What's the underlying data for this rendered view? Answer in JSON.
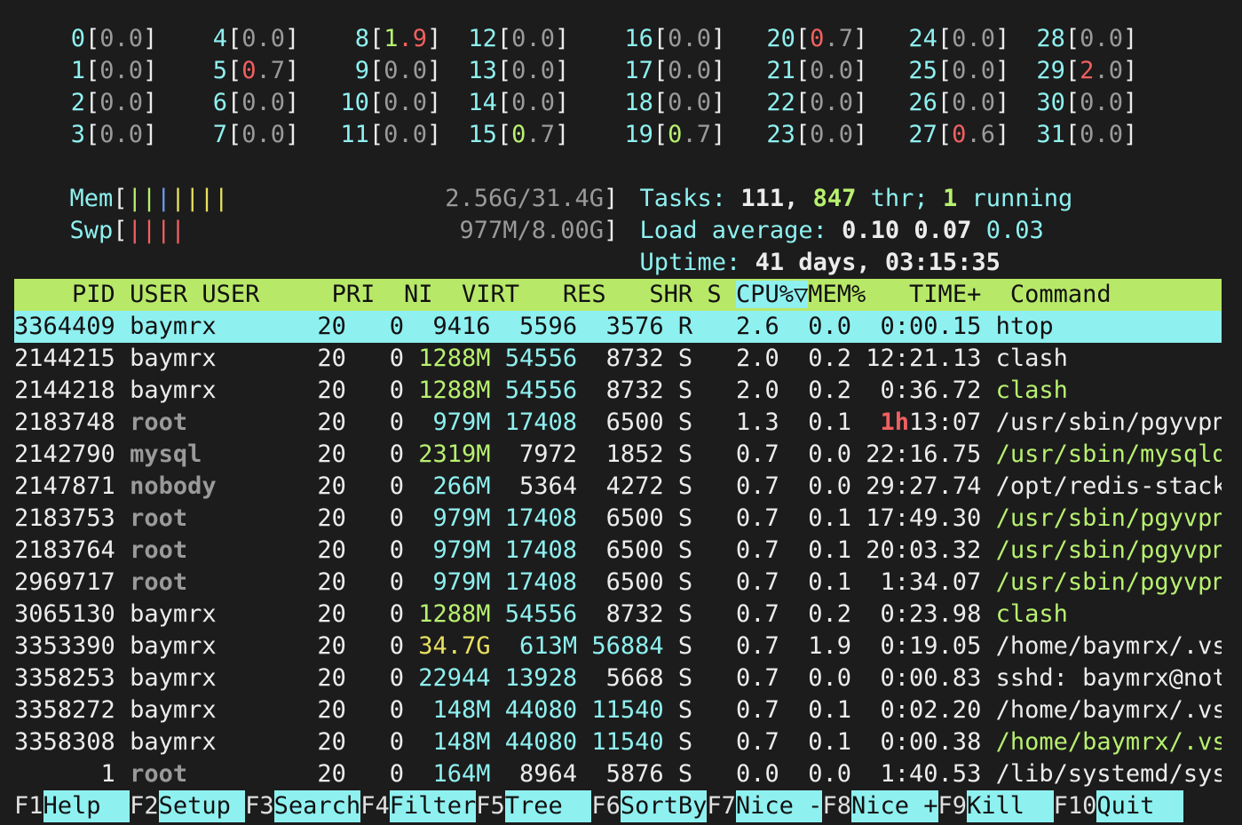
{
  "cpus": [
    {
      "id": "0",
      "a": "0",
      "b": ".0",
      "ac": "gray"
    },
    {
      "id": "1",
      "a": "0",
      "b": ".0",
      "ac": "gray"
    },
    {
      "id": "2",
      "a": "0",
      "b": ".0",
      "ac": "gray"
    },
    {
      "id": "3",
      "a": "0",
      "b": ".0",
      "ac": "gray"
    },
    {
      "id": "4",
      "a": "0",
      "b": ".0",
      "ac": "gray"
    },
    {
      "id": "5",
      "a": "0",
      "b": ".7",
      "ac": "red"
    },
    {
      "id": "6",
      "a": "0",
      "b": ".0",
      "ac": "gray"
    },
    {
      "id": "7",
      "a": "0",
      "b": ".0",
      "ac": "gray"
    },
    {
      "id": "8",
      "a": "1",
      "b": ".9",
      "ac": "green",
      "bc": "red"
    },
    {
      "id": "9",
      "a": "0",
      "b": ".0",
      "ac": "gray"
    },
    {
      "id": "10",
      "a": "0",
      "b": ".0",
      "ac": "gray"
    },
    {
      "id": "11",
      "a": "0",
      "b": ".0",
      "ac": "gray"
    },
    {
      "id": "12",
      "a": "0",
      "b": ".0",
      "ac": "gray"
    },
    {
      "id": "13",
      "a": "0",
      "b": ".0",
      "ac": "gray"
    },
    {
      "id": "14",
      "a": "0",
      "b": ".0",
      "ac": "gray"
    },
    {
      "id": "15",
      "a": "0",
      "b": ".7",
      "ac": "green"
    },
    {
      "id": "16",
      "a": "0",
      "b": ".0",
      "ac": "gray"
    },
    {
      "id": "17",
      "a": "0",
      "b": ".0",
      "ac": "gray"
    },
    {
      "id": "18",
      "a": "0",
      "b": ".0",
      "ac": "gray"
    },
    {
      "id": "19",
      "a": "0",
      "b": ".7",
      "ac": "green"
    },
    {
      "id": "20",
      "a": "0",
      "b": ".7",
      "ac": "red"
    },
    {
      "id": "21",
      "a": "0",
      "b": ".0",
      "ac": "gray"
    },
    {
      "id": "22",
      "a": "0",
      "b": ".0",
      "ac": "gray"
    },
    {
      "id": "23",
      "a": "0",
      "b": ".0",
      "ac": "gray"
    },
    {
      "id": "24",
      "a": "0",
      "b": ".0",
      "ac": "gray"
    },
    {
      "id": "25",
      "a": "0",
      "b": ".0",
      "ac": "gray"
    },
    {
      "id": "26",
      "a": "0",
      "b": ".0",
      "ac": "gray"
    },
    {
      "id": "27",
      "a": "0",
      "b": ".6",
      "ac": "red"
    },
    {
      "id": "28",
      "a": "0",
      "b": ".0",
      "ac": "gray"
    },
    {
      "id": "29",
      "a": "2",
      "b": ".0",
      "ac": "red"
    },
    {
      "id": "30",
      "a": "0",
      "b": ".0",
      "ac": "gray"
    },
    {
      "id": "31",
      "a": "0",
      "b": ".0",
      "ac": "gray"
    }
  ],
  "mem": {
    "label": "Mem",
    "bars": [
      {
        "text": "||",
        "color": "#b8f070"
      },
      {
        "text": "|",
        "color": "#6b9cf0"
      },
      {
        "text": "|",
        "color": "#e8e060"
      },
      {
        "text": "||",
        "color": "#e8e060"
      },
      {
        "text": "|",
        "color": "#e8e060"
      }
    ],
    "value": "2.56G/31.4G"
  },
  "swp": {
    "label": "Swp",
    "bars": [
      {
        "text": "||||",
        "color": "#f06060"
      }
    ],
    "value": "977M/8.00G"
  },
  "tasks": {
    "label": "Tasks: ",
    "count": "111",
    "sep": ", ",
    "threads": "847",
    "thr_label": " thr; ",
    "running": "1",
    "running_label": " running"
  },
  "load": {
    "label": "Load average: ",
    "l1": "0.10",
    "l5": "0.07",
    "l15": "0.03"
  },
  "uptime": {
    "label": "Uptime: ",
    "value": "41 days, 03:15:35"
  },
  "header": {
    "pid": "PID",
    "user": "USER",
    "pri": "PRI",
    "ni": "NI",
    "virt": "VIRT",
    "res": "RES",
    "shr": "SHR",
    "s": "S",
    "cpu": "CPU%▽",
    "mem": "MEM%",
    "time": "TIME+",
    "cmd": "Command"
  },
  "processes": [
    {
      "pid": "3364409",
      "user": "baymrx",
      "pri": "20",
      "ni": "0",
      "virt": "9416",
      "res": "5596",
      "shr": "3576",
      "s": "R",
      "cpu": "2.6",
      "mem": "0.0",
      "time": "0:00.15",
      "cmd": "htop",
      "selected": true
    },
    {
      "pid": "2144215",
      "user": "baymrx",
      "pri": "20",
      "ni": "0",
      "virt": "1288M",
      "res": "54556",
      "shr": "8732",
      "s": "S",
      "cpu": "2.0",
      "mem": "0.2",
      "time": "12:21.13",
      "cmd": "clash"
    },
    {
      "pid": "2144218",
      "user": "baymrx",
      "pri": "20",
      "ni": "0",
      "virt": "1288M",
      "res": "54556",
      "shr": "8732",
      "s": "S",
      "cpu": "2.0",
      "mem": "0.2",
      "time": "0:36.72",
      "cmd": "clash",
      "thread": true
    },
    {
      "pid": "2183748",
      "user": "root",
      "pri": "20",
      "ni": "0",
      "virt": "979M",
      "res": "17408",
      "shr": "6500",
      "s": "S",
      "cpu": "1.3",
      "mem": "0.1",
      "time_h": "1h",
      "time": "13:07",
      "cmd": "/usr/sbin/pgyvpn_svr"
    },
    {
      "pid": "2142790",
      "user": "mysql",
      "pri": "20",
      "ni": "0",
      "virt": "2319M",
      "res": "7972",
      "shr": "1852",
      "s": "S",
      "cpu": "0.7",
      "mem": "0.0",
      "time": "22:16.75",
      "cmd": "/usr/sbin/mysqld",
      "thread": true
    },
    {
      "pid": "2147871",
      "user": "nobody",
      "pri": "20",
      "ni": "0",
      "virt": "266M",
      "res": "5364",
      "shr": "4272",
      "s": "S",
      "cpu": "0.7",
      "mem": "0.0",
      "time": "29:27.74",
      "cmd": "/opt/redis-stack/bin"
    },
    {
      "pid": "2183753",
      "user": "root",
      "pri": "20",
      "ni": "0",
      "virt": "979M",
      "res": "17408",
      "shr": "6500",
      "s": "S",
      "cpu": "0.7",
      "mem": "0.1",
      "time": "17:49.30",
      "cmd": "/usr/sbin/pgyvpn_svr",
      "thread": true
    },
    {
      "pid": "2183764",
      "user": "root",
      "pri": "20",
      "ni": "0",
      "virt": "979M",
      "res": "17408",
      "shr": "6500",
      "s": "S",
      "cpu": "0.7",
      "mem": "0.1",
      "time": "20:03.32",
      "cmd": "/usr/sbin/pgyvpn_svr",
      "thread": true
    },
    {
      "pid": "2969717",
      "user": "root",
      "pri": "20",
      "ni": "0",
      "virt": "979M",
      "res": "17408",
      "shr": "6500",
      "s": "S",
      "cpu": "0.7",
      "mem": "0.1",
      "time": "1:34.07",
      "cmd": "/usr/sbin/pgyvpn_svr",
      "thread": true
    },
    {
      "pid": "3065130",
      "user": "baymrx",
      "pri": "20",
      "ni": "0",
      "virt": "1288M",
      "res": "54556",
      "shr": "8732",
      "s": "S",
      "cpu": "0.7",
      "mem": "0.2",
      "time": "0:23.98",
      "cmd": "clash",
      "thread": true
    },
    {
      "pid": "3353390",
      "user": "baymrx",
      "pri": "20",
      "ni": "0",
      "virt": "34.7G",
      "res": "613M",
      "shr": "56884",
      "s": "S",
      "cpu": "0.7",
      "mem": "1.9",
      "time": "0:19.05",
      "cmd": "/home/baymrx/.vscode"
    },
    {
      "pid": "3358253",
      "user": "baymrx",
      "pri": "20",
      "ni": "0",
      "virt": "22944",
      "res": "13928",
      "shr": "5668",
      "s": "S",
      "cpu": "0.7",
      "mem": "0.0",
      "time": "0:00.83",
      "cmd": "sshd: baymrx@notty"
    },
    {
      "pid": "3358272",
      "user": "baymrx",
      "pri": "20",
      "ni": "0",
      "virt": "148M",
      "res": "44080",
      "shr": "11540",
      "s": "S",
      "cpu": "0.7",
      "mem": "0.1",
      "time": "0:02.20",
      "cmd": "/home/baymrx/.vscode"
    },
    {
      "pid": "3358308",
      "user": "baymrx",
      "pri": "20",
      "ni": "0",
      "virt": "148M",
      "res": "44080",
      "shr": "11540",
      "s": "S",
      "cpu": "0.7",
      "mem": "0.1",
      "time": "0:00.38",
      "cmd": "/home/baymrx/.vscode",
      "thread": true
    },
    {
      "pid": "1",
      "user": "root",
      "pri": "20",
      "ni": "0",
      "virt": "164M",
      "res": "8964",
      "shr": "5876",
      "s": "S",
      "cpu": "0.0",
      "mem": "0.0",
      "time": "1:40.53",
      "cmd": "/lib/systemd/systemd"
    }
  ],
  "fkeys": [
    {
      "key": "F1",
      "label": "Help  "
    },
    {
      "key": "F2",
      "label": "Setup "
    },
    {
      "key": "F3",
      "label": "Search"
    },
    {
      "key": "F4",
      "label": "Filter"
    },
    {
      "key": "F5",
      "label": "Tree  "
    },
    {
      "key": "F6",
      "label": "SortBy"
    },
    {
      "key": "F7",
      "label": "Nice -"
    },
    {
      "key": "F8",
      "label": "Nice +"
    },
    {
      "key": "F9",
      "label": "Kill  "
    },
    {
      "key": "F10",
      "label": "Quit  "
    }
  ],
  "colors": {
    "background": "#1c1c1c",
    "header_bg": "#b8e868",
    "selected_bg": "#8ff0f0",
    "cyan": "#8ff0f0",
    "green": "#b8f070",
    "red": "#f06060"
  }
}
